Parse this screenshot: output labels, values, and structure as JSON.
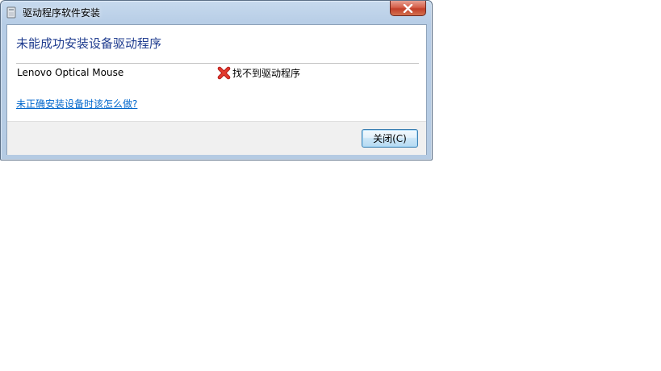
{
  "window": {
    "title": "驱动程序软件安装",
    "icon": "driver-install-icon"
  },
  "titlebar": {
    "close_icon": "close-icon"
  },
  "dialog": {
    "heading": "未能成功安装设备驱动程序",
    "device": {
      "name": "Lenovo Optical Mouse",
      "status_icon": "red-x-error-icon",
      "status": "找不到驱动程序"
    },
    "help_link": "未正确安装设备时该怎么做?",
    "close_button": "关闭(C)"
  },
  "colors": {
    "heading": "#1f3c8f",
    "link": "#0066cc",
    "error_icon": "#d41d1d",
    "title_close": "#c7442e"
  }
}
